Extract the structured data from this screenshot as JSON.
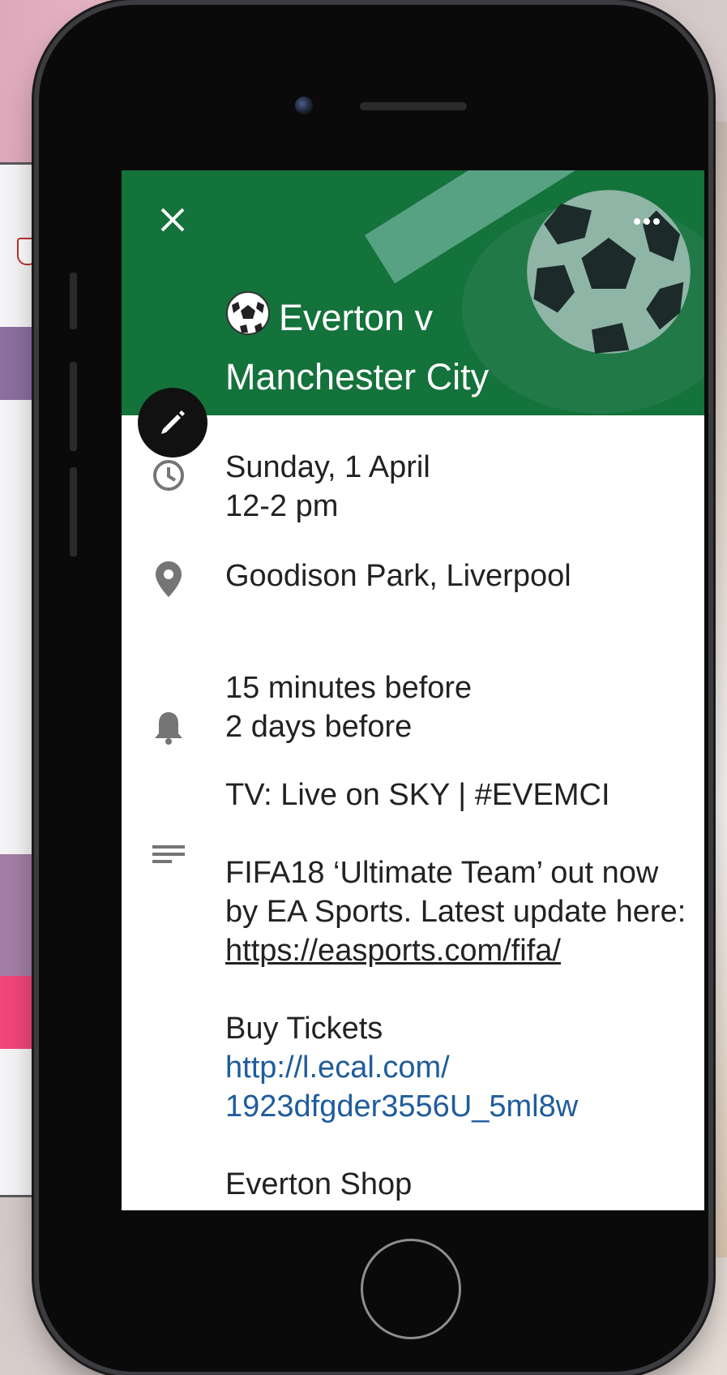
{
  "event": {
    "title_line1": "Everton v",
    "title_line2": "Manchester City",
    "date": "Sunday, 1 April",
    "time": "12-2 pm",
    "location": "Goodison Park, Liverpool",
    "reminders": [
      "15 minutes before",
      "2 days before"
    ],
    "description": {
      "tv": "TV: Live on SKY | #EVEMCI",
      "fifa_text": "FIFA18 ‘Ultimate Team’ out now by EA Sports. Latest update here: ",
      "fifa_link": "https://easports.com/fifa/",
      "tickets_label": "Buy Tickets",
      "tickets_link_line1": "http://l.ecal.com/",
      "tickets_link_line2": "1923dfgder3556U_5ml8w",
      "shop_label": "Everton Shop"
    }
  },
  "icons": {
    "close": "close-icon",
    "more": "more-icon",
    "edit": "pencil-icon",
    "time": "clock-icon",
    "location": "location-pin-icon",
    "reminder": "bell-icon",
    "description": "notes-icon"
  },
  "colors": {
    "header_green": "#14723b",
    "link_blue": "#1f5c9c",
    "fab": "#111111"
  }
}
